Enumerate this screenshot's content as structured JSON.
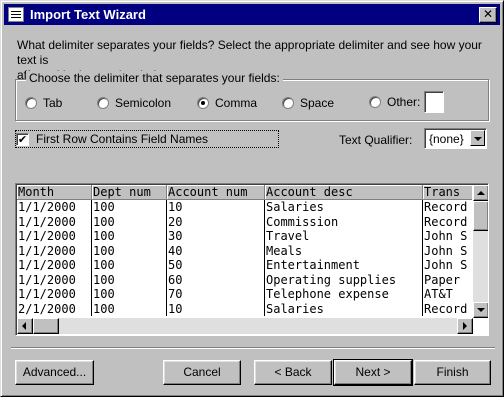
{
  "window": {
    "title": "Import Text Wizard",
    "close_glyph": "✕",
    "icon": "wizard-app-icon"
  },
  "instructions": "What delimiter separates your fields?  Select the appropriate delimiter and see how your text is\naffected in the preview below.",
  "delimiter_group": {
    "legend": "Choose the delimiter that separates your fields:",
    "options": [
      {
        "label": "Tab",
        "checked": false
      },
      {
        "label": "Semicolon",
        "checked": false
      },
      {
        "label": "Comma",
        "checked": true
      },
      {
        "label": "Space",
        "checked": false
      },
      {
        "label": "Other:",
        "checked": false
      }
    ],
    "other_value": ""
  },
  "first_row_checkbox": {
    "label": "First Row Contains Field Names",
    "checked": true,
    "check_glyph": "✔"
  },
  "text_qualifier": {
    "label": "Text Qualifier:",
    "value": "{none}"
  },
  "preview": {
    "columns": [
      "Month",
      "Dept num",
      "Account num",
      "Account desc",
      "Trans"
    ],
    "rows": [
      [
        "1/1/2000",
        "100",
        "10",
        "Salaries",
        "Record"
      ],
      [
        "1/1/2000",
        "100",
        "20",
        "Commission",
        "Record"
      ],
      [
        "1/1/2000",
        "100",
        "30",
        "Travel",
        "John S"
      ],
      [
        "1/1/2000",
        "100",
        "40",
        "Meals",
        "John S"
      ],
      [
        "1/1/2000",
        "100",
        "50",
        "Entertainment",
        "John S"
      ],
      [
        "1/1/2000",
        "100",
        "60",
        "Operating supplies",
        "Paper"
      ],
      [
        "1/1/2000",
        "100",
        "70",
        "Telephone expense",
        "AT&T"
      ],
      [
        "2/1/2000",
        "100",
        "10",
        "Salaries",
        "Record"
      ]
    ]
  },
  "buttons": {
    "advanced": "Advanced...",
    "cancel": "Cancel",
    "back": "< Back",
    "next": "Next >",
    "finish": "Finish"
  }
}
